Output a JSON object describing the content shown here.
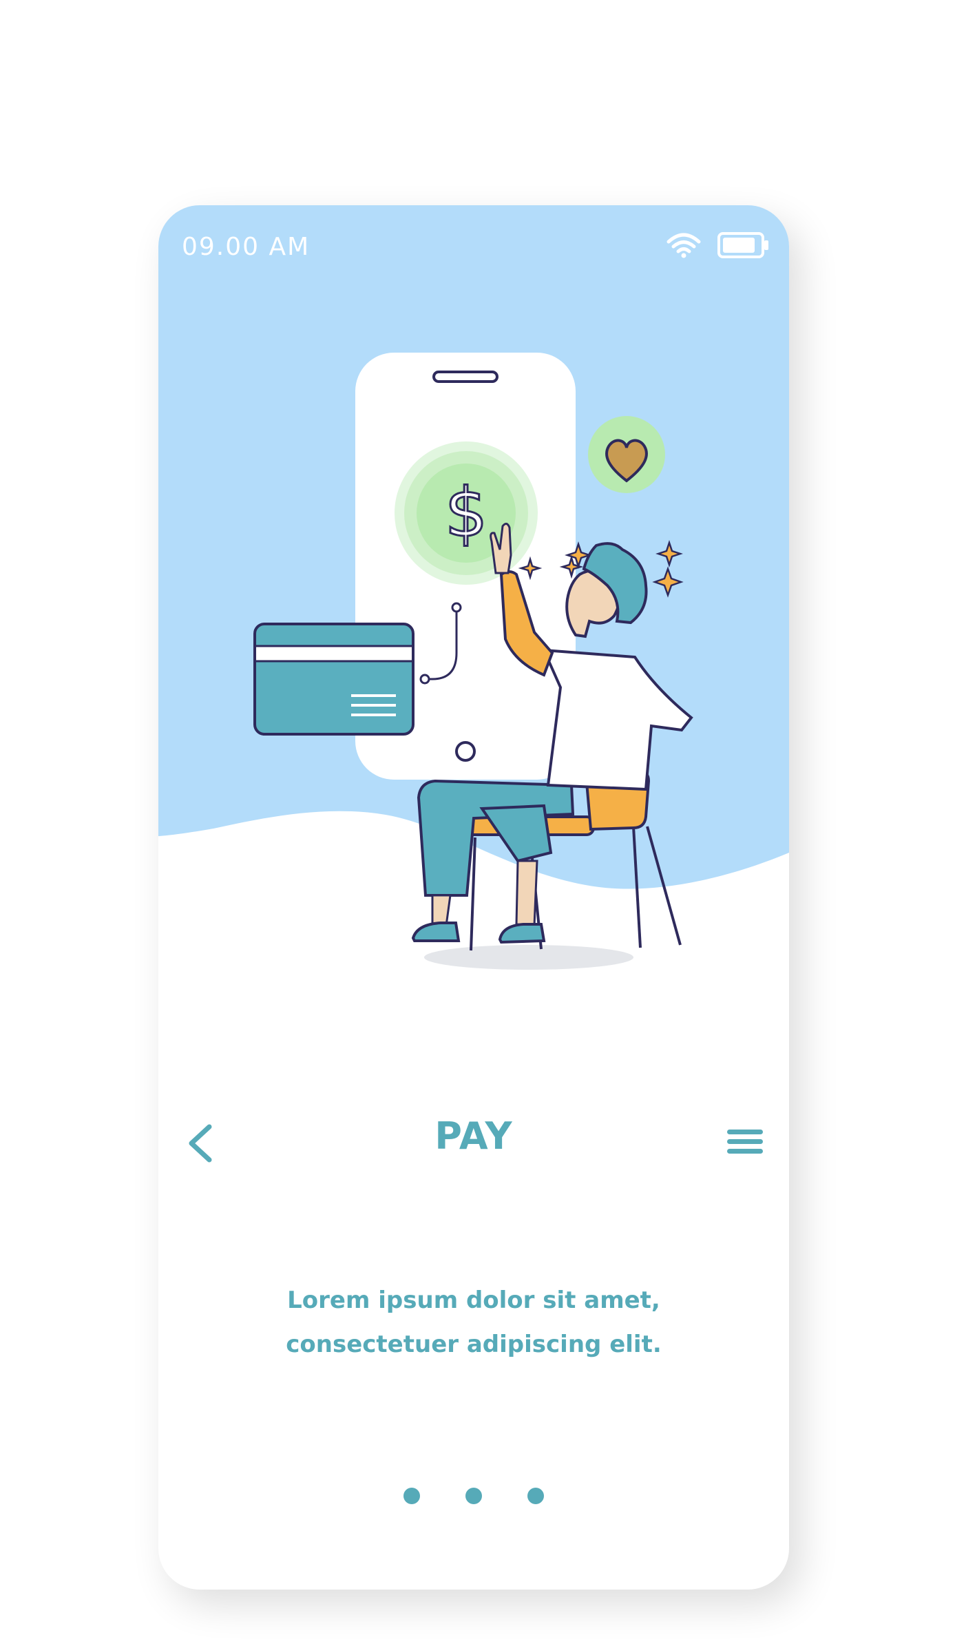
{
  "status_bar": {
    "time": "09.00 AM",
    "wifi_icon": "wifi-icon",
    "battery_icon": "battery-icon"
  },
  "header": {
    "title": "PAY",
    "back_icon": "chevron-left-icon",
    "menu_icon": "hamburger-menu-icon"
  },
  "content": {
    "line1": "Lorem ipsum dolor sit amet,",
    "line2": "consectetuer adipiscing elit."
  },
  "pagination": {
    "dots": 3
  },
  "illustration": {
    "currency_symbol": "$",
    "colors": {
      "sky": "#b3dcfa",
      "accent": "#56aab8",
      "green": "#b8eab0",
      "orange": "#f5b047",
      "outline": "#2e2a5c"
    }
  }
}
